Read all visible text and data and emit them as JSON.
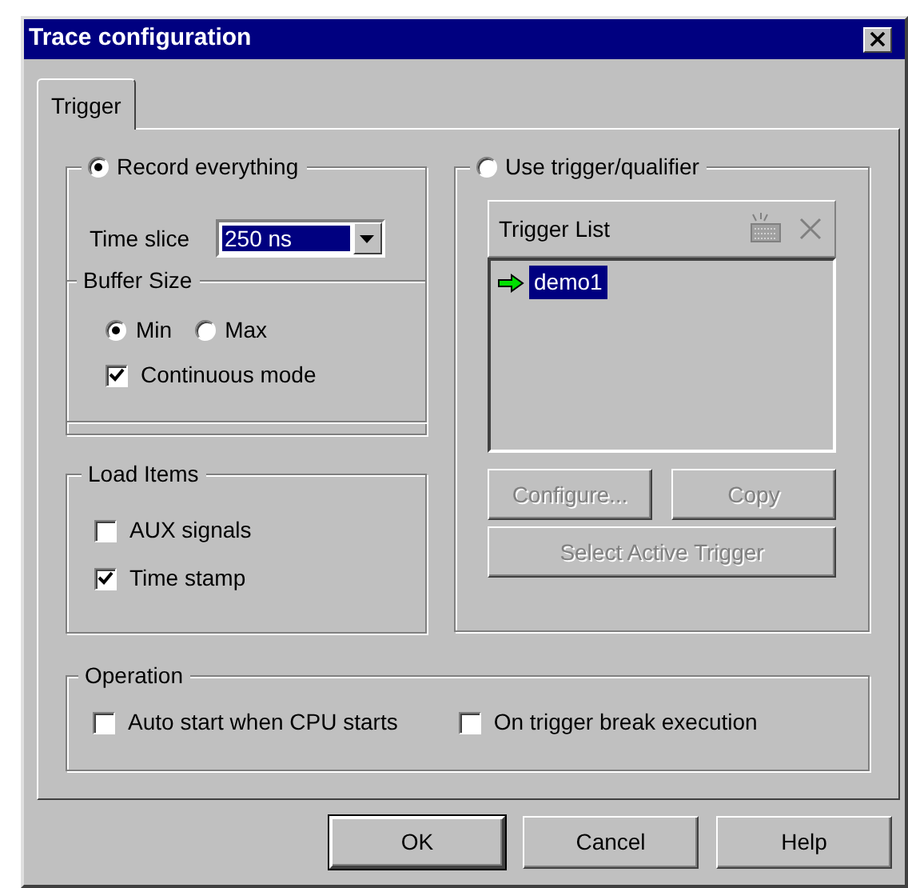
{
  "window": {
    "title": "Trace configuration"
  },
  "tabs": [
    {
      "label": "Trigger",
      "selected": true
    }
  ],
  "record_group": {
    "label": "Record everything",
    "selected": true,
    "time_slice": {
      "label": "Time slice",
      "value": "250 ns"
    },
    "buffer_size": {
      "title": "Buffer Size",
      "options": [
        {
          "label": "Min",
          "selected": true
        },
        {
          "label": "Max",
          "selected": false
        }
      ],
      "continuous_mode": {
        "label": "Continuous mode",
        "checked": true
      }
    }
  },
  "load_items": {
    "title": "Load Items",
    "items": [
      {
        "label": "AUX signals",
        "checked": false
      },
      {
        "label": "Time stamp",
        "checked": true
      }
    ]
  },
  "trigger_group": {
    "label": "Use trigger/qualifier",
    "selected": false,
    "list_title": "Trigger List",
    "items": [
      {
        "label": "demo1",
        "selected": true
      }
    ],
    "buttons": [
      {
        "label": "Configure...",
        "disabled": true
      },
      {
        "label": "Copy",
        "disabled": true
      },
      {
        "label": "Select Active Trigger",
        "disabled": true
      }
    ]
  },
  "operation": {
    "title": "Operation",
    "items": [
      {
        "label": "Auto start when CPU starts",
        "checked": false
      },
      {
        "label": "On trigger break execution",
        "checked": false
      }
    ]
  },
  "buttons": [
    {
      "label": "OK",
      "default": true
    },
    {
      "label": "Cancel",
      "default": false
    },
    {
      "label": "Help",
      "default": false
    }
  ]
}
